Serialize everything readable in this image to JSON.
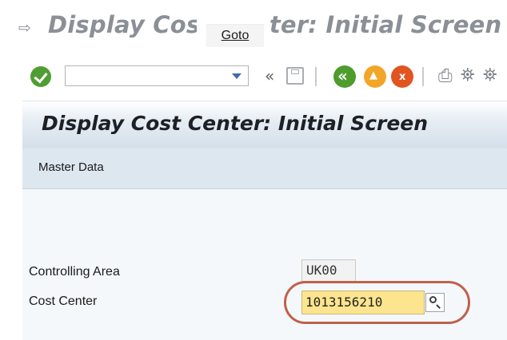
{
  "window": {
    "title": "Display Cost Center: Initial Screen",
    "tooltip": "Goto"
  },
  "toolbar": {
    "command_field_value": "",
    "icons": [
      "enter-icon",
      "command-field",
      "fold-icon",
      "save-icon",
      "back-icon",
      "exit-icon",
      "cancel-icon",
      "print-icon",
      "find-icon",
      "find-next-icon"
    ]
  },
  "screen": {
    "title": "Display Cost Center: Initial Screen",
    "master_data_button": "Master Data"
  },
  "form": {
    "controlling_area_label": "Controlling Area",
    "controlling_area_value": "UK00",
    "cost_center_label": "Cost Center",
    "cost_center_value": "1013156210"
  },
  "colors": {
    "accent_highlight": "#c0614a",
    "input_focus": "#fde58f",
    "header_bg": "#d4dfea"
  }
}
